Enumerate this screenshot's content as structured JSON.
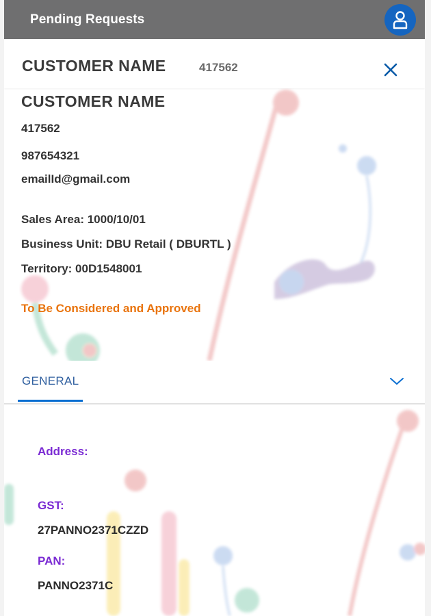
{
  "shellbar": {
    "title": "Pending Requests",
    "avatar_icon": "user-icon",
    "background": "#6f6f70",
    "avatar_color": "#1565c0"
  },
  "header": {
    "customer_name": "CUSTOMER NAME",
    "customer_id": "417562",
    "close_icon": "close-icon"
  },
  "details": {
    "customer_name": "CUSTOMER NAME",
    "customer_id": "417562",
    "phone": "987654321",
    "email": "emailId@gmail.com",
    "sales_area": "Sales Area: 1000/10/01",
    "business_unit": "Business Unit: DBU Retail ( DBURTL )",
    "territory": "Territory: 00D1548001",
    "status": "To Be Considered and Approved",
    "status_color": "#e9730c"
  },
  "tabs": {
    "general_label": "GENERAL",
    "expand_icon": "chevron-down-icon",
    "accent": "#0a6ed1"
  },
  "general": {
    "address_label": "Address:",
    "address_value": "",
    "gst_label": "GST:",
    "gst_value": "27PANNO2371CZZD",
    "pan_label": "PAN:",
    "pan_value": "PANNO2371C",
    "label_color": "#7a2ad3"
  }
}
